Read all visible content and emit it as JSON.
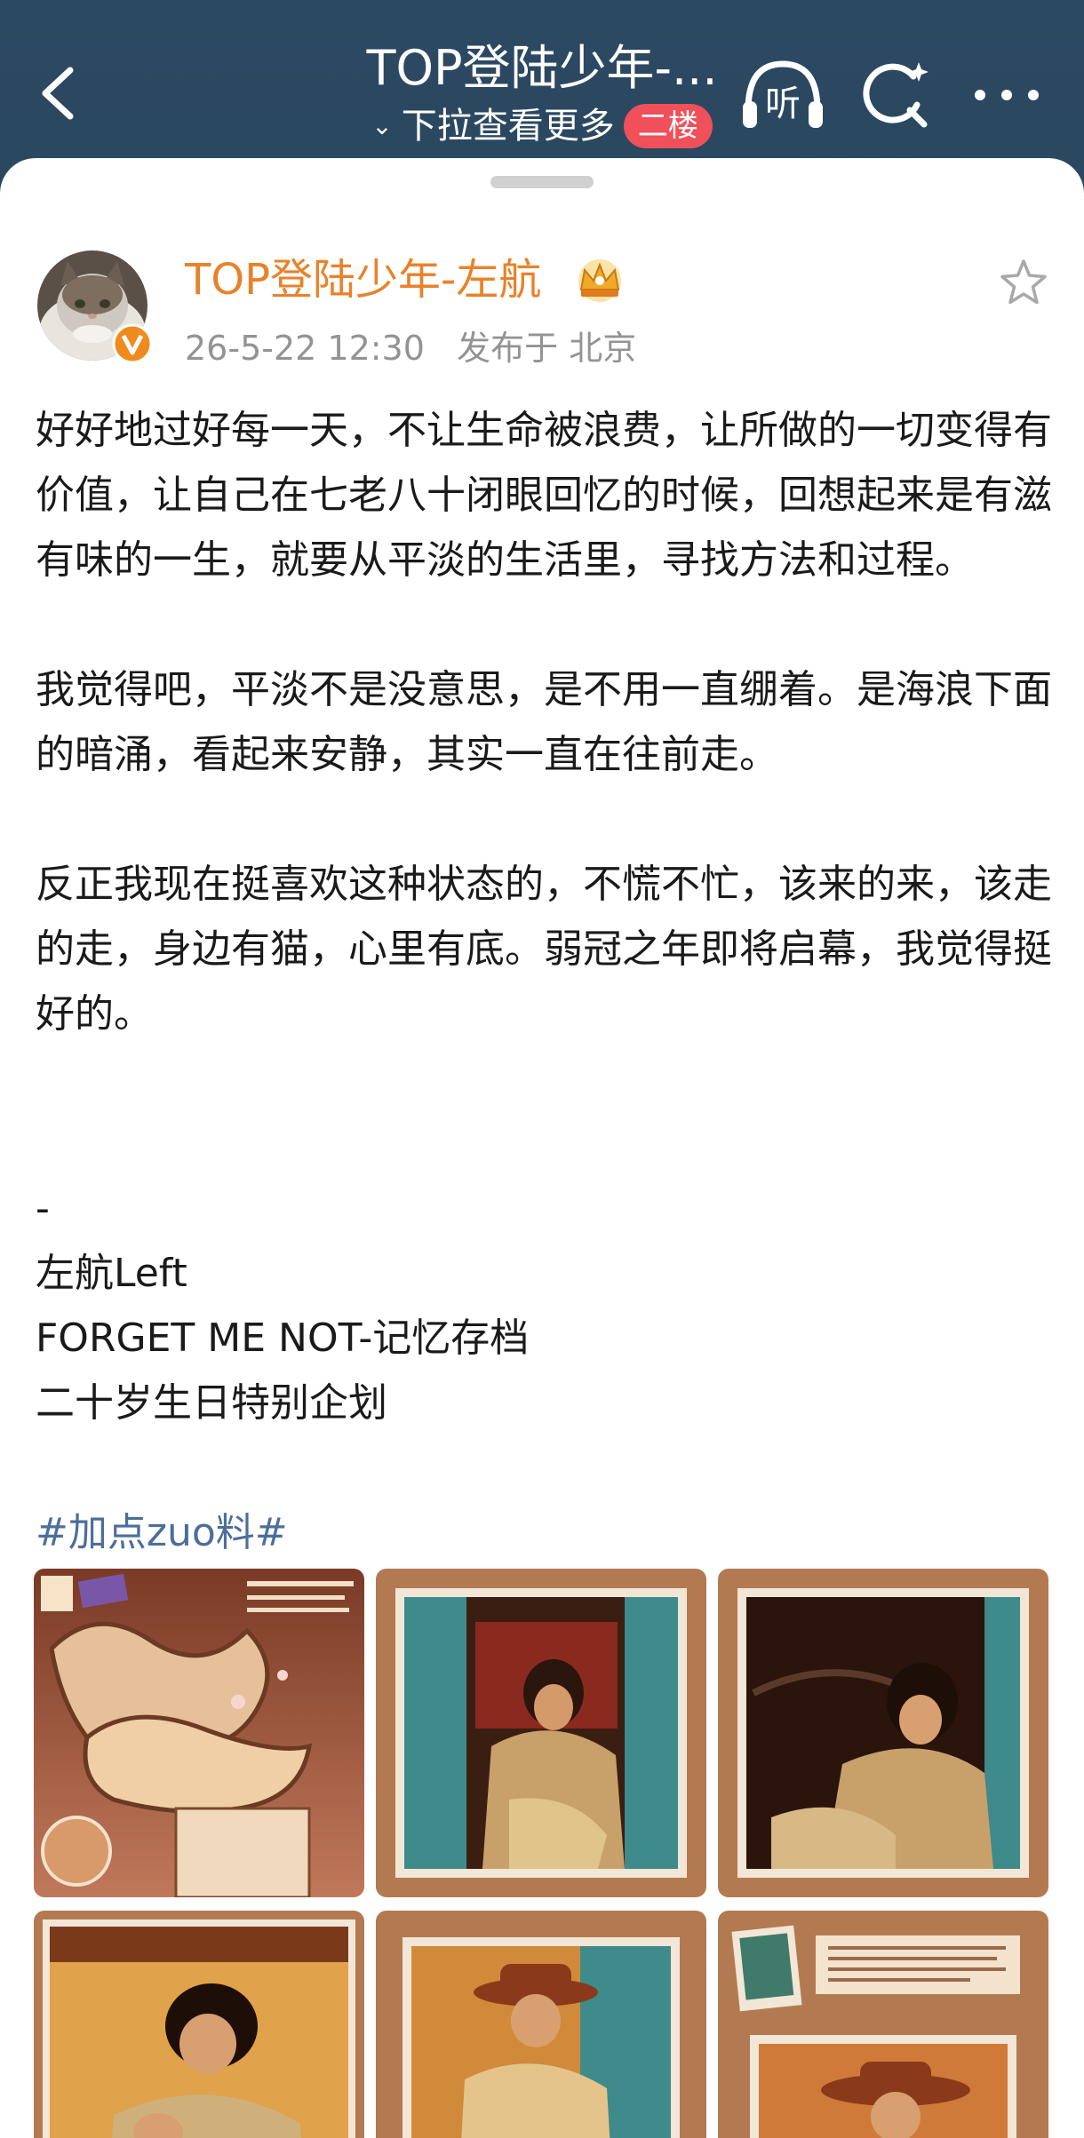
{
  "header": {
    "title": "TOP登陆少年-...",
    "subtitle": "下拉查看更多",
    "floor_badge": "二楼",
    "listen_label": "听",
    "icons": {
      "back": "chevron-left-icon",
      "listen": "headphones-icon",
      "search": "search-icon",
      "more": "more-dots-icon"
    }
  },
  "post": {
    "author": "TOP登陆少年-左航",
    "timestamp": "26-5-22 12:30",
    "location_label": "发布于 北京",
    "paragraphs": [
      "好好地过好每一天，不让生命被浪费，让所做的一切变得有价值，让自己在七老八十闭眼回忆的时候，回想起来是有滋有味的一生，就要从平淡的生活里，寻找方法和过程。",
      "我觉得吧，平淡不是没意思，是不用一直绷着。是海浪下面的暗涌，看起来安静，其实一直在往前走。",
      "反正我现在挺喜欢这种状态的，不慌不忙，该来的来，该走的走，身边有猫，心里有底。弱冠之年即将启幕，我觉得挺好的。"
    ],
    "signature_lines": [
      "-",
      "左航Left",
      "FORGET ME NOT-记忆存档",
      "二十岁生日特别企划"
    ],
    "hashtag": "#加点zuo料#",
    "image_alts": [
      "FORGET ME NOT poster",
      "photo in vintage car",
      "photo in vintage car 2",
      "photo portrait with hand",
      "photo with hat",
      "photo with letter"
    ]
  },
  "colors": {
    "nav_bg": "#2c4962",
    "author_name": "#e8822a",
    "hashtag": "#4d6e9a",
    "badge_red": "#f0505a",
    "verified_orange": "#f08a1c"
  }
}
